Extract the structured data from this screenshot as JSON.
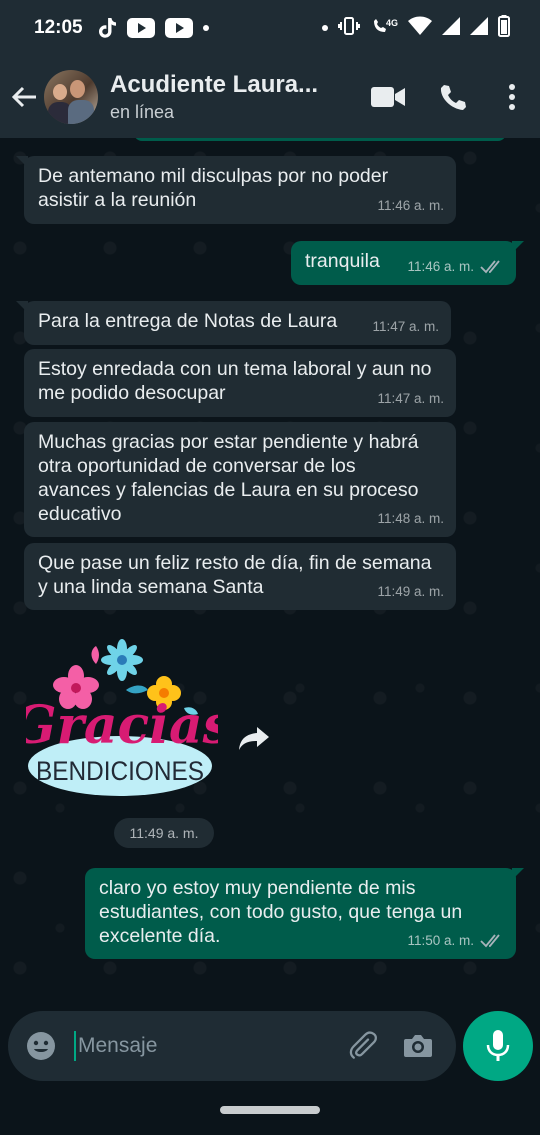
{
  "status_bar": {
    "time": "12:05",
    "icons": [
      "tiktok-icon",
      "youtube-icon",
      "youtube-icon",
      "dot",
      "dot",
      "vibrate-icon",
      "volte-4g-icon",
      "wifi-icon",
      "signal-icon",
      "signal-icon",
      "battery-icon"
    ],
    "network_label": "4G"
  },
  "header": {
    "contact_name": "Acudiente Laura...",
    "status": "en línea"
  },
  "messages": [
    {
      "direction": "in",
      "text": "De antemano mil disculpas por no poder\nasistir a la reunión",
      "time": "11:46 a. m."
    },
    {
      "direction": "out",
      "text": "tranquila",
      "time": "11:46 a. m.",
      "status": "read"
    },
    {
      "direction": "in",
      "text": "Para la entrega de Notas de Laura",
      "time": "11:47 a. m."
    },
    {
      "direction": "in",
      "text": "Estoy enredada con un tema laboral y aun no\nme podido desocupar",
      "time": "11:47 a. m."
    },
    {
      "direction": "in",
      "text": "Muchas gracias por estar pendiente y habrá\notra oportunidad de conversar de los\navances y falencias de Laura en su proceso\neducativo",
      "time": "11:48 a. m."
    },
    {
      "direction": "in",
      "text": "Que pase un feliz resto de día, fin de semana\ny una linda semana Santa",
      "time": "11:49 a. m."
    },
    {
      "direction": "out",
      "text": "claro yo estoy muy pendiente de mis\nestudiantes, con todo gusto, que tenga un\nexcelente día.",
      "time": "11:50 a. m.",
      "status": "read"
    }
  ],
  "sticker": {
    "word_top": "Gracias",
    "word_bottom": "BENDICIONES",
    "time": "11:49 a. m."
  },
  "input": {
    "placeholder": "Mensaje"
  },
  "colors": {
    "background": "#0b141a",
    "header": "#1f2c34",
    "incoming_bubble": "#202c33",
    "outgoing_bubble": "#005c4b",
    "accent": "#00a884",
    "read_ticks": "#a7b3ba"
  }
}
